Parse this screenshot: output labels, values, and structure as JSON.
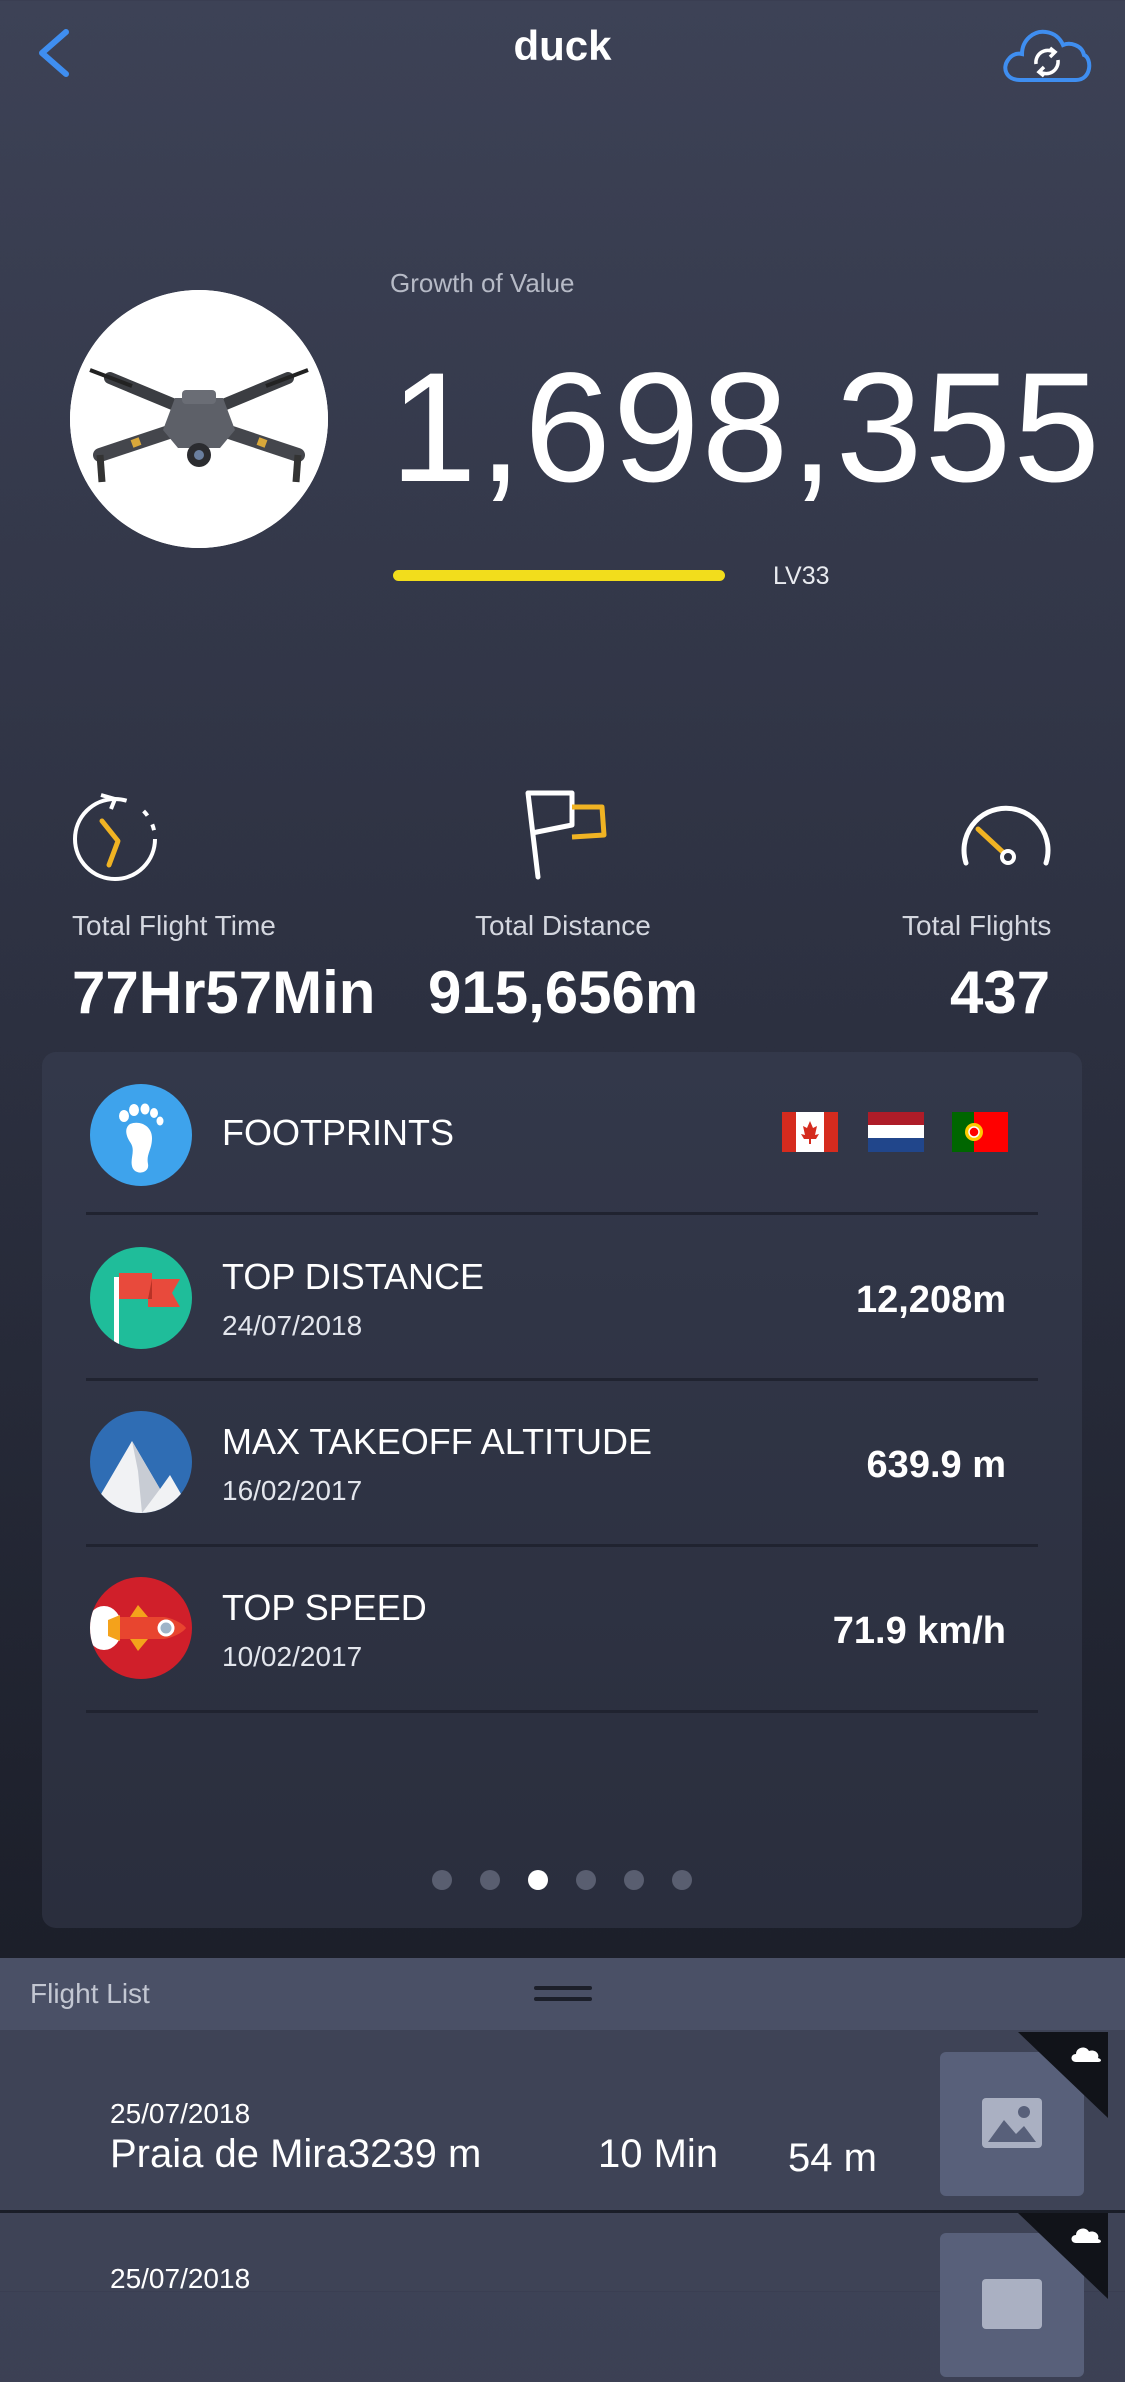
{
  "header": {
    "title": "duck"
  },
  "growth": {
    "label": "Growth of Value",
    "value": "1,698,355",
    "level": "LV33",
    "progress": 0.65
  },
  "stats": [
    {
      "label": "Total Flight Time",
      "value": "77Hr57Min"
    },
    {
      "label": "Total Distance",
      "value": "915,656m"
    },
    {
      "label": "Total Flights",
      "value": "437"
    }
  ],
  "card": {
    "footprints": {
      "title": "FOOTPRINTS",
      "flags": [
        "canada-flag",
        "netherlands-flag",
        "portugal-flag"
      ]
    },
    "rows": [
      {
        "title": "TOP DISTANCE",
        "date": "24/07/2018",
        "value": "12,208m"
      },
      {
        "title": "MAX TAKEOFF ALTITUDE",
        "date": "16/02/2017",
        "value": "639.9 m"
      },
      {
        "title": "TOP SPEED",
        "date": "10/02/2017",
        "value": "71.9 km/h"
      }
    ],
    "pagination": {
      "count": 6,
      "active": 3
    }
  },
  "flight_list": {
    "title": "Flight List",
    "items": [
      {
        "date": "25/07/2018",
        "name": "Praia de Mira3239 m",
        "duration": "10 Min",
        "altitude": "54 m"
      },
      {
        "date": "25/07/2018"
      }
    ]
  },
  "colors": {
    "accent_blue": "#3f8ef0",
    "level_bar": "#f2dd1c",
    "icon_yellow": "#f0b323"
  }
}
